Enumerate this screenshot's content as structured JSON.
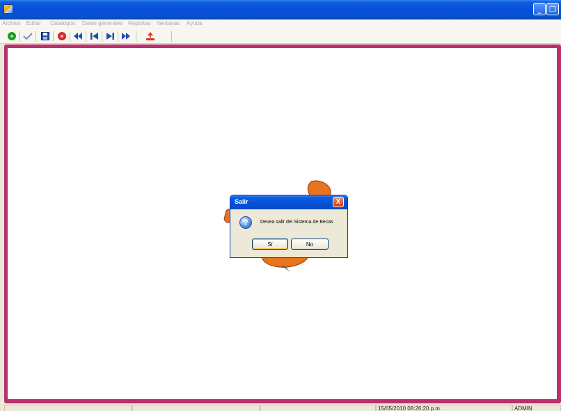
{
  "menu": {
    "items": [
      "Archivo",
      "Editar",
      "Catalogos",
      "Datos generales",
      "Reportes",
      "Ventanas",
      "Ayuda"
    ]
  },
  "window_controls": {
    "minimize": "_",
    "restore": "❐"
  },
  "toolbar": {
    "buttons": [
      {
        "icon": "add-icon",
        "color": "#1c9b1c"
      },
      {
        "icon": "edit-check-icon",
        "color": "#7a8fb0"
      },
      {
        "icon": "save-icon",
        "color": "#1e4fb0"
      },
      {
        "icon": "cancel-icon",
        "color": "#d52525"
      },
      {
        "icon": "previous-icon",
        "color": "#1e4fb0"
      },
      {
        "icon": "first-icon",
        "color": "#1e4fb0"
      },
      {
        "icon": "last-icon",
        "color": "#1e4fb0"
      },
      {
        "icon": "next-icon",
        "color": "#1e4fb0"
      },
      {
        "icon": "exit-icon",
        "color": "#e03a1e"
      }
    ]
  },
  "dialog": {
    "title": "Salir",
    "close": "X",
    "icon": "question-icon",
    "message": "Desea salir del Sistema de Becas",
    "yes_label": "Sí",
    "no_label": "No"
  },
  "status": {
    "datetime": "15/05/2010 08:26:20 p.m.",
    "user": "ADMIN"
  },
  "colors": {
    "mdi_border": "#b9306c",
    "titlebar": "#0551d8",
    "logo": "#e8741e"
  }
}
